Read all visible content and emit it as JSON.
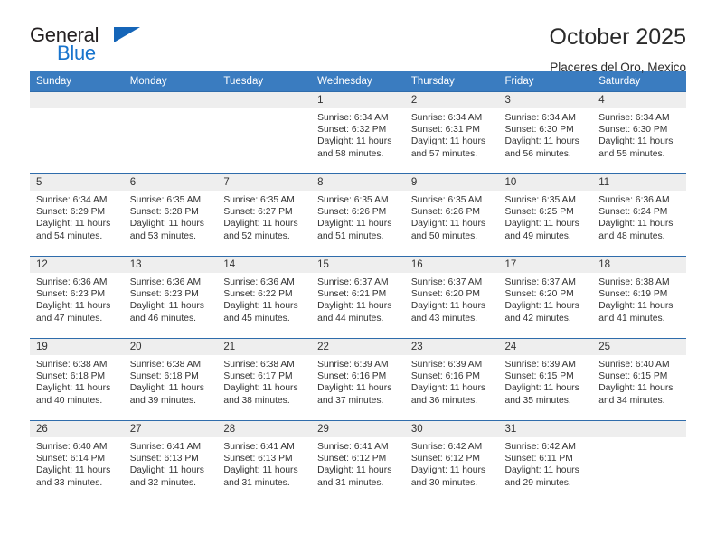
{
  "brand": {
    "name_part1": "General",
    "name_part2": "Blue",
    "triangle_icon": "brand-triangle-icon",
    "colors": {
      "dark": "#231f20",
      "blue": "#1874cd"
    }
  },
  "header": {
    "title": "October 2025",
    "location": "Placeres del Oro, Mexico"
  },
  "calendar": {
    "accent_color": "#3a7cc0",
    "daynum_band_color": "#eeeeee",
    "weekday_headers": [
      "Sunday",
      "Monday",
      "Tuesday",
      "Wednesday",
      "Thursday",
      "Friday",
      "Saturday"
    ],
    "weeks": [
      [
        {
          "day": "",
          "sunrise": "",
          "sunset": "",
          "daylight_line1": "",
          "daylight_line2": ""
        },
        {
          "day": "",
          "sunrise": "",
          "sunset": "",
          "daylight_line1": "",
          "daylight_line2": ""
        },
        {
          "day": "",
          "sunrise": "",
          "sunset": "",
          "daylight_line1": "",
          "daylight_line2": ""
        },
        {
          "day": "1",
          "sunrise": "Sunrise: 6:34 AM",
          "sunset": "Sunset: 6:32 PM",
          "daylight_line1": "Daylight: 11 hours",
          "daylight_line2": "and 58 minutes."
        },
        {
          "day": "2",
          "sunrise": "Sunrise: 6:34 AM",
          "sunset": "Sunset: 6:31 PM",
          "daylight_line1": "Daylight: 11 hours",
          "daylight_line2": "and 57 minutes."
        },
        {
          "day": "3",
          "sunrise": "Sunrise: 6:34 AM",
          "sunset": "Sunset: 6:30 PM",
          "daylight_line1": "Daylight: 11 hours",
          "daylight_line2": "and 56 minutes."
        },
        {
          "day": "4",
          "sunrise": "Sunrise: 6:34 AM",
          "sunset": "Sunset: 6:30 PM",
          "daylight_line1": "Daylight: 11 hours",
          "daylight_line2": "and 55 minutes."
        }
      ],
      [
        {
          "day": "5",
          "sunrise": "Sunrise: 6:34 AM",
          "sunset": "Sunset: 6:29 PM",
          "daylight_line1": "Daylight: 11 hours",
          "daylight_line2": "and 54 minutes."
        },
        {
          "day": "6",
          "sunrise": "Sunrise: 6:35 AM",
          "sunset": "Sunset: 6:28 PM",
          "daylight_line1": "Daylight: 11 hours",
          "daylight_line2": "and 53 minutes."
        },
        {
          "day": "7",
          "sunrise": "Sunrise: 6:35 AM",
          "sunset": "Sunset: 6:27 PM",
          "daylight_line1": "Daylight: 11 hours",
          "daylight_line2": "and 52 minutes."
        },
        {
          "day": "8",
          "sunrise": "Sunrise: 6:35 AM",
          "sunset": "Sunset: 6:26 PM",
          "daylight_line1": "Daylight: 11 hours",
          "daylight_line2": "and 51 minutes."
        },
        {
          "day": "9",
          "sunrise": "Sunrise: 6:35 AM",
          "sunset": "Sunset: 6:26 PM",
          "daylight_line1": "Daylight: 11 hours",
          "daylight_line2": "and 50 minutes."
        },
        {
          "day": "10",
          "sunrise": "Sunrise: 6:35 AM",
          "sunset": "Sunset: 6:25 PM",
          "daylight_line1": "Daylight: 11 hours",
          "daylight_line2": "and 49 minutes."
        },
        {
          "day": "11",
          "sunrise": "Sunrise: 6:36 AM",
          "sunset": "Sunset: 6:24 PM",
          "daylight_line1": "Daylight: 11 hours",
          "daylight_line2": "and 48 minutes."
        }
      ],
      [
        {
          "day": "12",
          "sunrise": "Sunrise: 6:36 AM",
          "sunset": "Sunset: 6:23 PM",
          "daylight_line1": "Daylight: 11 hours",
          "daylight_line2": "and 47 minutes."
        },
        {
          "day": "13",
          "sunrise": "Sunrise: 6:36 AM",
          "sunset": "Sunset: 6:23 PM",
          "daylight_line1": "Daylight: 11 hours",
          "daylight_line2": "and 46 minutes."
        },
        {
          "day": "14",
          "sunrise": "Sunrise: 6:36 AM",
          "sunset": "Sunset: 6:22 PM",
          "daylight_line1": "Daylight: 11 hours",
          "daylight_line2": "and 45 minutes."
        },
        {
          "day": "15",
          "sunrise": "Sunrise: 6:37 AM",
          "sunset": "Sunset: 6:21 PM",
          "daylight_line1": "Daylight: 11 hours",
          "daylight_line2": "and 44 minutes."
        },
        {
          "day": "16",
          "sunrise": "Sunrise: 6:37 AM",
          "sunset": "Sunset: 6:20 PM",
          "daylight_line1": "Daylight: 11 hours",
          "daylight_line2": "and 43 minutes."
        },
        {
          "day": "17",
          "sunrise": "Sunrise: 6:37 AM",
          "sunset": "Sunset: 6:20 PM",
          "daylight_line1": "Daylight: 11 hours",
          "daylight_line2": "and 42 minutes."
        },
        {
          "day": "18",
          "sunrise": "Sunrise: 6:38 AM",
          "sunset": "Sunset: 6:19 PM",
          "daylight_line1": "Daylight: 11 hours",
          "daylight_line2": "and 41 minutes."
        }
      ],
      [
        {
          "day": "19",
          "sunrise": "Sunrise: 6:38 AM",
          "sunset": "Sunset: 6:18 PM",
          "daylight_line1": "Daylight: 11 hours",
          "daylight_line2": "and 40 minutes."
        },
        {
          "day": "20",
          "sunrise": "Sunrise: 6:38 AM",
          "sunset": "Sunset: 6:18 PM",
          "daylight_line1": "Daylight: 11 hours",
          "daylight_line2": "and 39 minutes."
        },
        {
          "day": "21",
          "sunrise": "Sunrise: 6:38 AM",
          "sunset": "Sunset: 6:17 PM",
          "daylight_line1": "Daylight: 11 hours",
          "daylight_line2": "and 38 minutes."
        },
        {
          "day": "22",
          "sunrise": "Sunrise: 6:39 AM",
          "sunset": "Sunset: 6:16 PM",
          "daylight_line1": "Daylight: 11 hours",
          "daylight_line2": "and 37 minutes."
        },
        {
          "day": "23",
          "sunrise": "Sunrise: 6:39 AM",
          "sunset": "Sunset: 6:16 PM",
          "daylight_line1": "Daylight: 11 hours",
          "daylight_line2": "and 36 minutes."
        },
        {
          "day": "24",
          "sunrise": "Sunrise: 6:39 AM",
          "sunset": "Sunset: 6:15 PM",
          "daylight_line1": "Daylight: 11 hours",
          "daylight_line2": "and 35 minutes."
        },
        {
          "day": "25",
          "sunrise": "Sunrise: 6:40 AM",
          "sunset": "Sunset: 6:15 PM",
          "daylight_line1": "Daylight: 11 hours",
          "daylight_line2": "and 34 minutes."
        }
      ],
      [
        {
          "day": "26",
          "sunrise": "Sunrise: 6:40 AM",
          "sunset": "Sunset: 6:14 PM",
          "daylight_line1": "Daylight: 11 hours",
          "daylight_line2": "and 33 minutes."
        },
        {
          "day": "27",
          "sunrise": "Sunrise: 6:41 AM",
          "sunset": "Sunset: 6:13 PM",
          "daylight_line1": "Daylight: 11 hours",
          "daylight_line2": "and 32 minutes."
        },
        {
          "day": "28",
          "sunrise": "Sunrise: 6:41 AM",
          "sunset": "Sunset: 6:13 PM",
          "daylight_line1": "Daylight: 11 hours",
          "daylight_line2": "and 31 minutes."
        },
        {
          "day": "29",
          "sunrise": "Sunrise: 6:41 AM",
          "sunset": "Sunset: 6:12 PM",
          "daylight_line1": "Daylight: 11 hours",
          "daylight_line2": "and 31 minutes."
        },
        {
          "day": "30",
          "sunrise": "Sunrise: 6:42 AM",
          "sunset": "Sunset: 6:12 PM",
          "daylight_line1": "Daylight: 11 hours",
          "daylight_line2": "and 30 minutes."
        },
        {
          "day": "31",
          "sunrise": "Sunrise: 6:42 AM",
          "sunset": "Sunset: 6:11 PM",
          "daylight_line1": "Daylight: 11 hours",
          "daylight_line2": "and 29 minutes."
        },
        {
          "day": "",
          "sunrise": "",
          "sunset": "",
          "daylight_line1": "",
          "daylight_line2": ""
        }
      ]
    ]
  }
}
